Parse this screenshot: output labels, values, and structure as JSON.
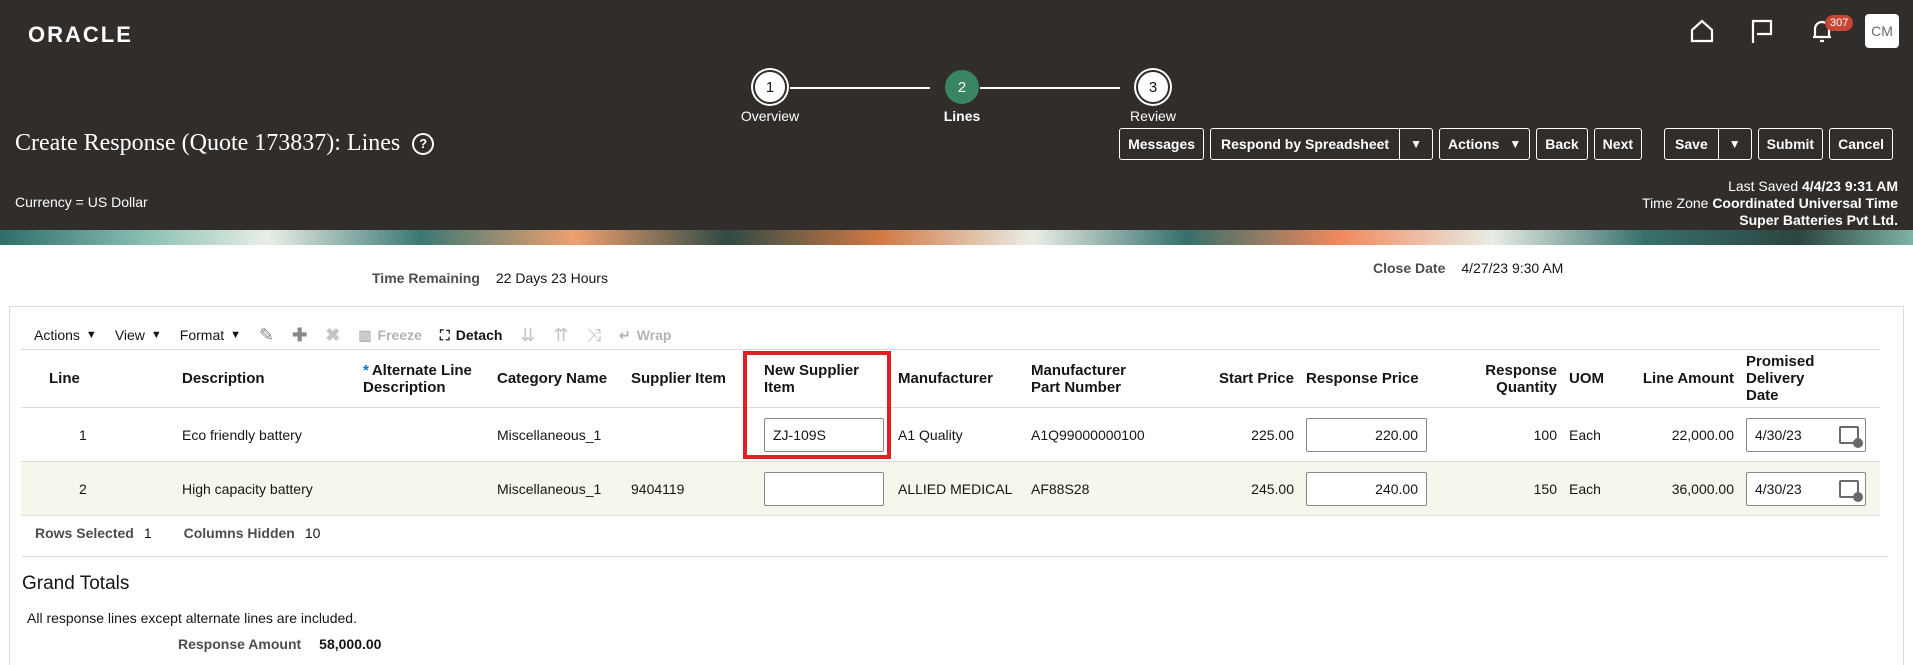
{
  "app": {
    "logo": "ORACLE"
  },
  "header": {
    "notification_count": "307",
    "avatar_initials": "CM",
    "title": "Create Response (Quote 173837): Lines",
    "currency": "Currency = US Dollar",
    "last_saved_label": "Last Saved",
    "last_saved_value": "4/4/23 9:31 AM",
    "timezone_label": "Time Zone",
    "timezone_value": "Coordinated Universal Time",
    "company": "Super Batteries Pvt Ltd."
  },
  "train": {
    "steps": [
      {
        "num": "1",
        "label": "Overview"
      },
      {
        "num": "2",
        "label": "Lines"
      },
      {
        "num": "3",
        "label": "Review"
      }
    ]
  },
  "toolbar": {
    "messages": "Messages",
    "respond_spreadsheet": "Respond by Spreadsheet",
    "actions": "Actions",
    "back": "Back",
    "next": "Next",
    "save": "Save",
    "submit": "Submit",
    "cancel": "Cancel"
  },
  "info": {
    "time_remaining_label": "Time Remaining",
    "time_remaining_value": "22 Days 23 Hours",
    "close_date_label": "Close Date",
    "close_date_value": "4/27/23 9:30 AM"
  },
  "table_toolbar": {
    "actions": "Actions",
    "view": "View",
    "format": "Format",
    "freeze": "Freeze",
    "detach": "Detach",
    "wrap": "Wrap"
  },
  "columns": {
    "line": "Line",
    "description": "Description",
    "alt_desc_1": "Alternate Line",
    "alt_desc_2": "Description",
    "category": "Category Name",
    "supplier_item": "Supplier Item",
    "new_supplier_1": "New Supplier",
    "new_supplier_2": "Item",
    "manufacturer": "Manufacturer",
    "mfr_part_1": "Manufacturer",
    "mfr_part_2": "Part Number",
    "start_price": "Start Price",
    "response_price": "Response Price",
    "resp_qty_1": "Response",
    "resp_qty_2": "Quantity",
    "uom": "UOM",
    "line_amount": "Line Amount",
    "promised_1": "Promised Delivery",
    "promised_2": "Date"
  },
  "rows": [
    {
      "line": "1",
      "description": "Eco friendly battery",
      "category": "Miscellaneous_1",
      "supplier_item": "",
      "new_supplier_item": "ZJ-109S",
      "manufacturer": "A1 Quality",
      "mfr_part": "A1Q99000000100",
      "start_price": "225.00",
      "response_price": "220.00",
      "quantity": "100",
      "uom": "Each",
      "line_amount": "22,000.00",
      "promised_date": "4/30/23"
    },
    {
      "line": "2",
      "description": "High capacity battery",
      "category": "Miscellaneous_1",
      "supplier_item": "9404119",
      "new_supplier_item": "",
      "manufacturer": "ALLIED MEDICAL",
      "mfr_part": "AF88S28",
      "start_price": "245.00",
      "response_price": "240.00",
      "quantity": "150",
      "uom": "Each",
      "line_amount": "36,000.00",
      "promised_date": "4/30/23"
    }
  ],
  "summary": {
    "rows_selected_label": "Rows Selected",
    "rows_selected_value": "1",
    "columns_hidden_label": "Columns Hidden",
    "columns_hidden_value": "10"
  },
  "totals": {
    "heading": "Grand Totals",
    "note": "All response lines except alternate lines are included.",
    "response_amount_label": "Response Amount",
    "response_amount_value": "58,000.00"
  },
  "colors": {
    "header_bg": "#312d2a",
    "active_step": "#398461",
    "link": "#0572ce",
    "highlight": "#e21e27"
  }
}
